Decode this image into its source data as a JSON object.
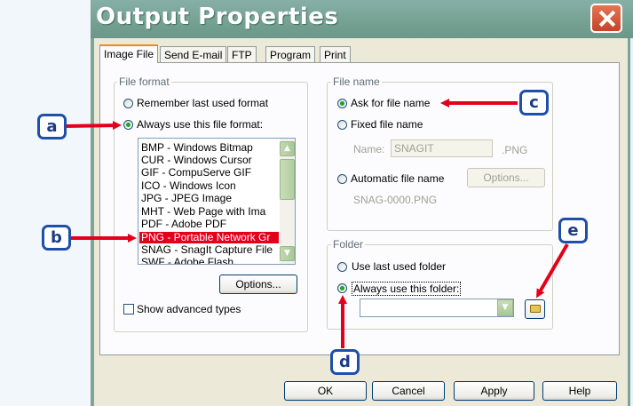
{
  "window": {
    "title": "Output Properties"
  },
  "tabs": [
    "Image File",
    "Send E-mail",
    "FTP",
    "Program",
    "Print"
  ],
  "file_format": {
    "label": "File format",
    "remember": "Remember last used format",
    "always": "Always use this file format:",
    "list": [
      "BMP - Windows Bitmap",
      "CUR - Windows Cursor",
      "GIF - CompuServe GIF",
      "ICO - Windows Icon",
      "JPG - JPEG Image",
      "MHT - Web Page with Ima",
      "PDF - Adobe PDF",
      "PNG - Portable Network Gr",
      "SNAG - SnagIt Capture File",
      "SWF - Adobe Flash"
    ],
    "selected_index": 7,
    "options_button": "Options...",
    "show_advanced": "Show advanced types"
  },
  "file_name": {
    "label": "File name",
    "ask": "Ask for file name",
    "fixed": "Fixed file name",
    "name_label": "Name:",
    "name_value": "SNAGIT",
    "ext": ".PNG",
    "automatic": "Automatic file name",
    "options_button": "Options...",
    "auto_example": "SNAG-0000.PNG"
  },
  "folder": {
    "label": "Folder",
    "use_last": "Use last used folder",
    "always": "Always use this folder:",
    "path_value": ""
  },
  "buttons": {
    "ok": "OK",
    "cancel": "Cancel",
    "apply": "Apply",
    "help": "Help"
  },
  "callouts": {
    "a": "a",
    "b": "b",
    "c": "c",
    "d": "d",
    "e": "e"
  },
  "colors": {
    "arrow": "#e3001b",
    "callout_border": "#1f4fa8",
    "selection": "#e2001a",
    "titlebar": "#76a293"
  },
  "icons": {
    "close": "close-icon",
    "folder": "folder-open-icon"
  }
}
